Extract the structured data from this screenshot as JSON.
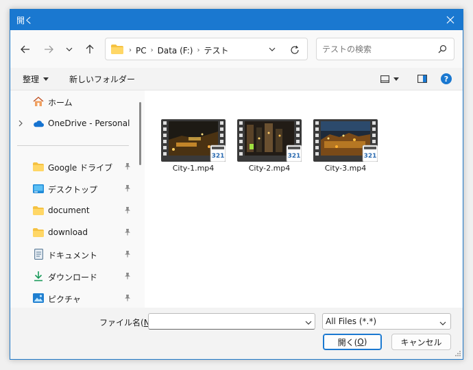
{
  "window": {
    "title": "開く",
    "accent": "#1a78d0"
  },
  "address": {
    "crumbs": [
      "PC",
      "Data (F:)",
      "テスト"
    ]
  },
  "search": {
    "placeholder": "テストの検索"
  },
  "toolbar": {
    "organize": "整理",
    "new_folder": "新しいフォルダー"
  },
  "sidebar": {
    "items": [
      {
        "label": "ホーム",
        "icon": "home-icon"
      },
      {
        "label": "OneDrive - Personal",
        "icon": "cloud-icon"
      },
      {
        "label": "Google ドライブ",
        "icon": "folder-icon"
      },
      {
        "label": "デスクトップ",
        "icon": "desktop-icon"
      },
      {
        "label": "document",
        "icon": "folder-icon"
      },
      {
        "label": "download",
        "icon": "folder-icon"
      },
      {
        "label": "ドキュメント",
        "icon": "document-icon"
      },
      {
        "label": "ダウンロード",
        "icon": "download-icon"
      },
      {
        "label": "ピクチャ",
        "icon": "pictures-icon"
      }
    ]
  },
  "files": [
    {
      "name": "City-1.mp4",
      "badge": "321"
    },
    {
      "name": "City-2.mp4",
      "badge": "321"
    },
    {
      "name": "City-3.mp4",
      "badge": "321"
    }
  ],
  "footer": {
    "filename_label_prefix": "ファイル名(",
    "filename_label_key": "N",
    "filename_label_suffix": "):",
    "filename_value": "",
    "filetype_value": "All Files (*.*)",
    "open_prefix": "開く(",
    "open_key": "O",
    "open_suffix": ")",
    "cancel_label": "キャンセル"
  }
}
